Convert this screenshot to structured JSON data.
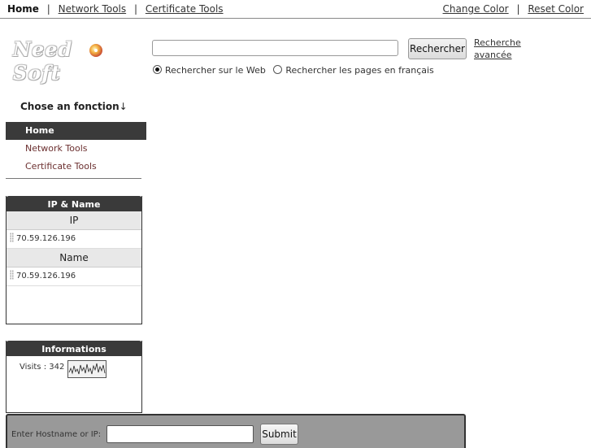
{
  "topnav": {
    "home": "Home",
    "network_tools": "Network Tools",
    "certificate_tools": "Certificate Tools",
    "sep": "|",
    "change_color": "Change Color",
    "reset_color": "Reset Color"
  },
  "logo": {
    "text": "Need Soft"
  },
  "search": {
    "value": "",
    "button": "Rechercher",
    "advanced": "Recherche avancée",
    "options": [
      {
        "label": "Rechercher sur le Web",
        "selected": true
      },
      {
        "label": "Rechercher les pages en français",
        "selected": false
      }
    ]
  },
  "sidebar": {
    "title": "Chose an fonction",
    "arrow": "↓",
    "items": [
      {
        "label": "Home",
        "active": true
      },
      {
        "label": "Network Tools",
        "active": false
      },
      {
        "label": "Certificate Tools",
        "active": false
      }
    ]
  },
  "ip_box": {
    "title": "IP & Name",
    "ip_header": "IP",
    "ip_value": "70.59.126.196",
    "name_header": "Name",
    "name_value": "70.59.126.196"
  },
  "info_box": {
    "title": "Informations",
    "visits_label": "Visits : 342"
  },
  "lookup": {
    "label": "Enter Hostname or IP:",
    "value": "",
    "submit": "Submit"
  }
}
